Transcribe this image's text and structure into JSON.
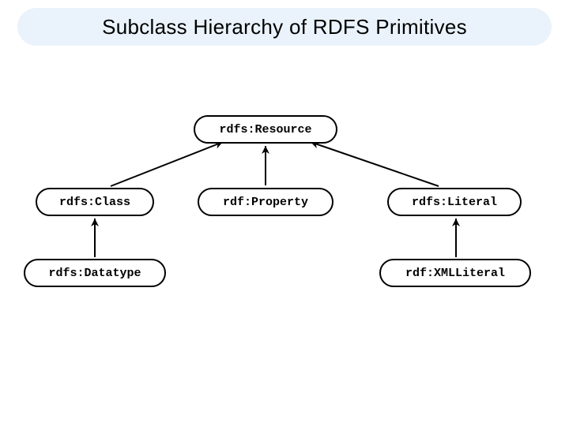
{
  "title": "Subclass Hierarchy of RDFS Primitives",
  "nodes": {
    "resource": "rdfs:Resource",
    "class": "rdfs:Class",
    "property": "rdf:Property",
    "literal": "rdfs:Literal",
    "datatype": "rdfs:Datatype",
    "xmlliteral": "rdf:XMLLiteral"
  },
  "diagram_data": {
    "type": "tree",
    "relation": "rdfs:subClassOf",
    "root": "rdfs:Resource",
    "edges": [
      {
        "child": "rdfs:Class",
        "parent": "rdfs:Resource"
      },
      {
        "child": "rdf:Property",
        "parent": "rdfs:Resource"
      },
      {
        "child": "rdfs:Literal",
        "parent": "rdfs:Resource"
      },
      {
        "child": "rdfs:Datatype",
        "parent": "rdfs:Class"
      },
      {
        "child": "rdf:XMLLiteral",
        "parent": "rdfs:Literal"
      }
    ]
  }
}
